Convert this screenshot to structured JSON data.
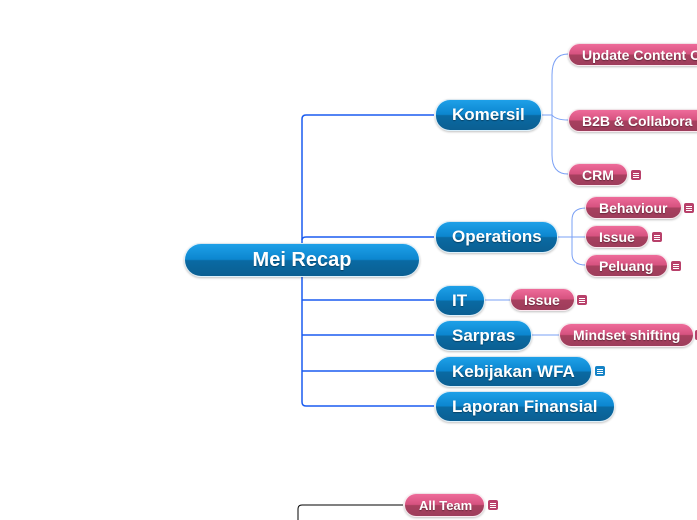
{
  "map": {
    "root": {
      "label": "Mei Recap"
    },
    "branches": [
      {
        "label": "Komersil",
        "has_note": false,
        "children": [
          {
            "label": "Update Content C",
            "has_note": false
          },
          {
            "label": "B2B & Collabora",
            "has_note": false
          },
          {
            "label": "CRM",
            "has_note": true
          }
        ]
      },
      {
        "label": "Operations",
        "has_note": false,
        "children": [
          {
            "label": "Behaviour",
            "has_note": true
          },
          {
            "label": "Issue",
            "has_note": true
          },
          {
            "label": "Peluang",
            "has_note": true
          }
        ]
      },
      {
        "label": "IT",
        "has_note": false,
        "children": [
          {
            "label": "Issue",
            "has_note": true
          }
        ]
      },
      {
        "label": "Sarpras",
        "has_note": false,
        "children": [
          {
            "label": "Mindset shifting",
            "has_note": true
          }
        ]
      },
      {
        "label": "Kebijakan WFA",
        "has_note": true,
        "children": []
      },
      {
        "label": "Laporan Finansial",
        "has_note": false,
        "children": []
      }
    ],
    "floating": [
      {
        "label": "All Team",
        "has_note": true
      }
    ]
  },
  "colors": {
    "main_topic": "#0c86cf",
    "sub_topic": "#c54b75",
    "connector": "#1a5cf0",
    "sub_connector": "#7aa0f5",
    "floating_connector": "#000000"
  }
}
